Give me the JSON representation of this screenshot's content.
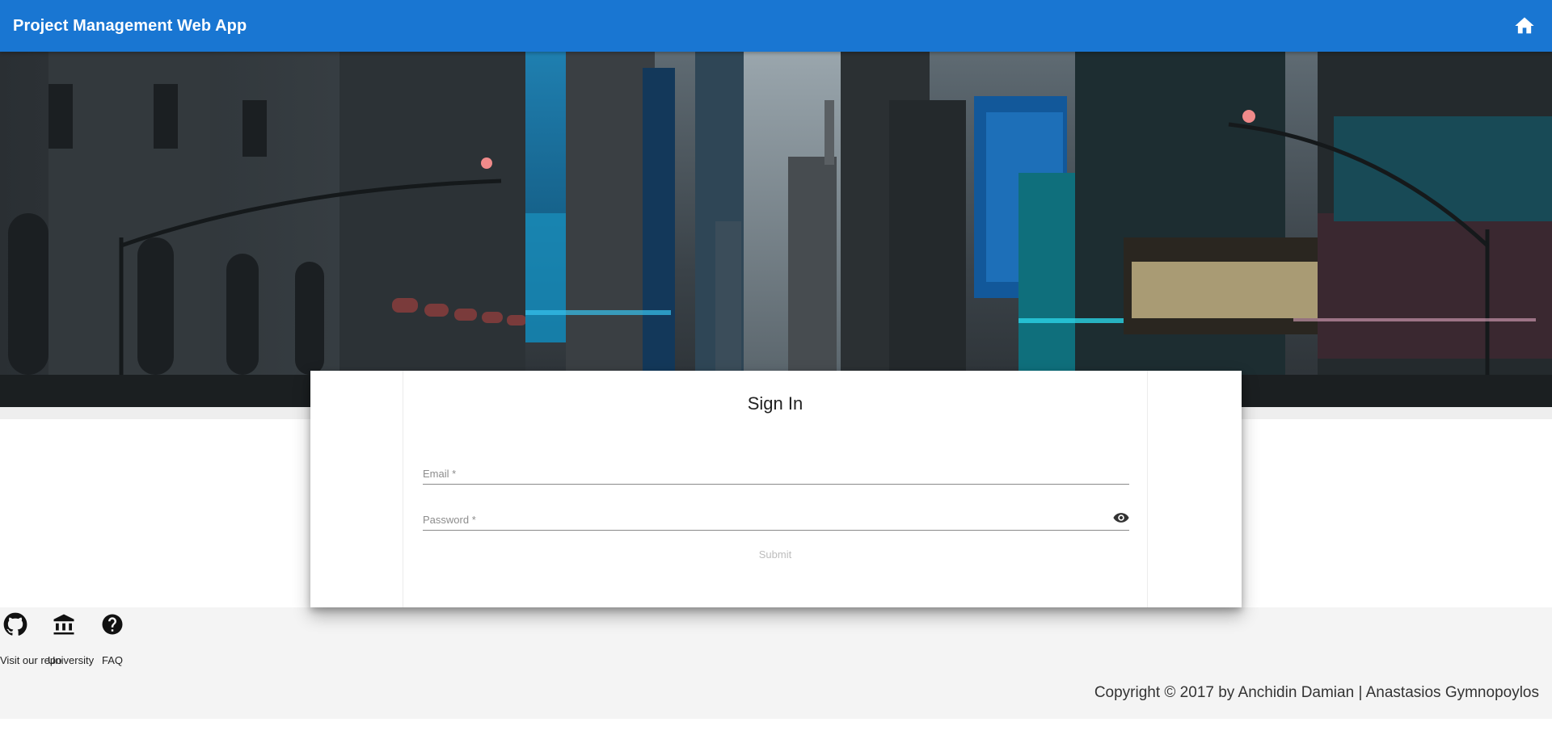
{
  "appbar": {
    "title": "Project Management Web App",
    "home_icon": "home-icon",
    "color": "#1976d2"
  },
  "hero": {
    "description_icon": "city-street-background"
  },
  "signin": {
    "title": "Sign In",
    "email_placeholder": "Email *",
    "email_value": "",
    "password_placeholder": "Password *",
    "password_value": "",
    "password_toggle_icon": "eye-icon",
    "submit_label": "Submit"
  },
  "footer": {
    "links": [
      {
        "label": "Visit our repo",
        "icon": "github-icon"
      },
      {
        "label": "University",
        "icon": "university-icon"
      },
      {
        "label": "FAQ",
        "icon": "help-icon"
      }
    ],
    "copyright": "Copyright © 2017 by Anchidin Damian | Anastasios Gymnopoylos"
  }
}
